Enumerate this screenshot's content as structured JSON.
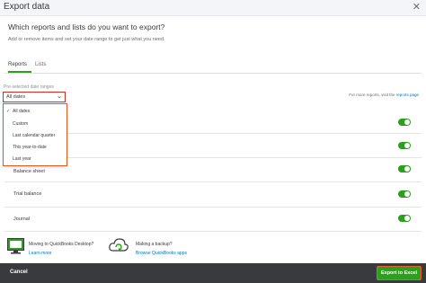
{
  "dialog": {
    "title": "Export data",
    "question": "Which reports and lists do you want to export?",
    "description": "Add or remove items and set your date range to get just what you need."
  },
  "tabs": [
    {
      "label": "Reports",
      "active": true
    },
    {
      "label": "Lists",
      "active": false
    }
  ],
  "date_range": {
    "label": "Pre-selected date ranges",
    "selected": "All dates",
    "options": [
      "All dates",
      "Custom",
      "Last calendar quarter",
      "This year-to-date",
      "Last year"
    ]
  },
  "reports_link": {
    "prefix": "For more reports, visit the",
    "link": "reports page"
  },
  "report_rows": [
    {
      "label": "",
      "enabled": true
    },
    {
      "label": "",
      "enabled": true
    },
    {
      "label": "",
      "enabled": true
    },
    {
      "label": "Balance sheet",
      "enabled": true
    },
    {
      "label": "Trial balance",
      "enabled": true
    },
    {
      "label": "Journal",
      "enabled": true
    }
  ],
  "promos": [
    {
      "title": "Moving to QuickBooks Desktop?",
      "link": "Learn more",
      "icon": "desktop-migration-icon"
    },
    {
      "title": "Making a backup?",
      "link": "Browse QuickBooks apps",
      "icon": "cloud-sync-icon"
    }
  ],
  "footer": {
    "cancel_label": "Cancel",
    "export_label": "Export to Excel"
  },
  "colors": {
    "accent": "#2ca01c",
    "link": "#0077c5",
    "footer": "#393a3d",
    "highlight": "#e35b1d"
  }
}
